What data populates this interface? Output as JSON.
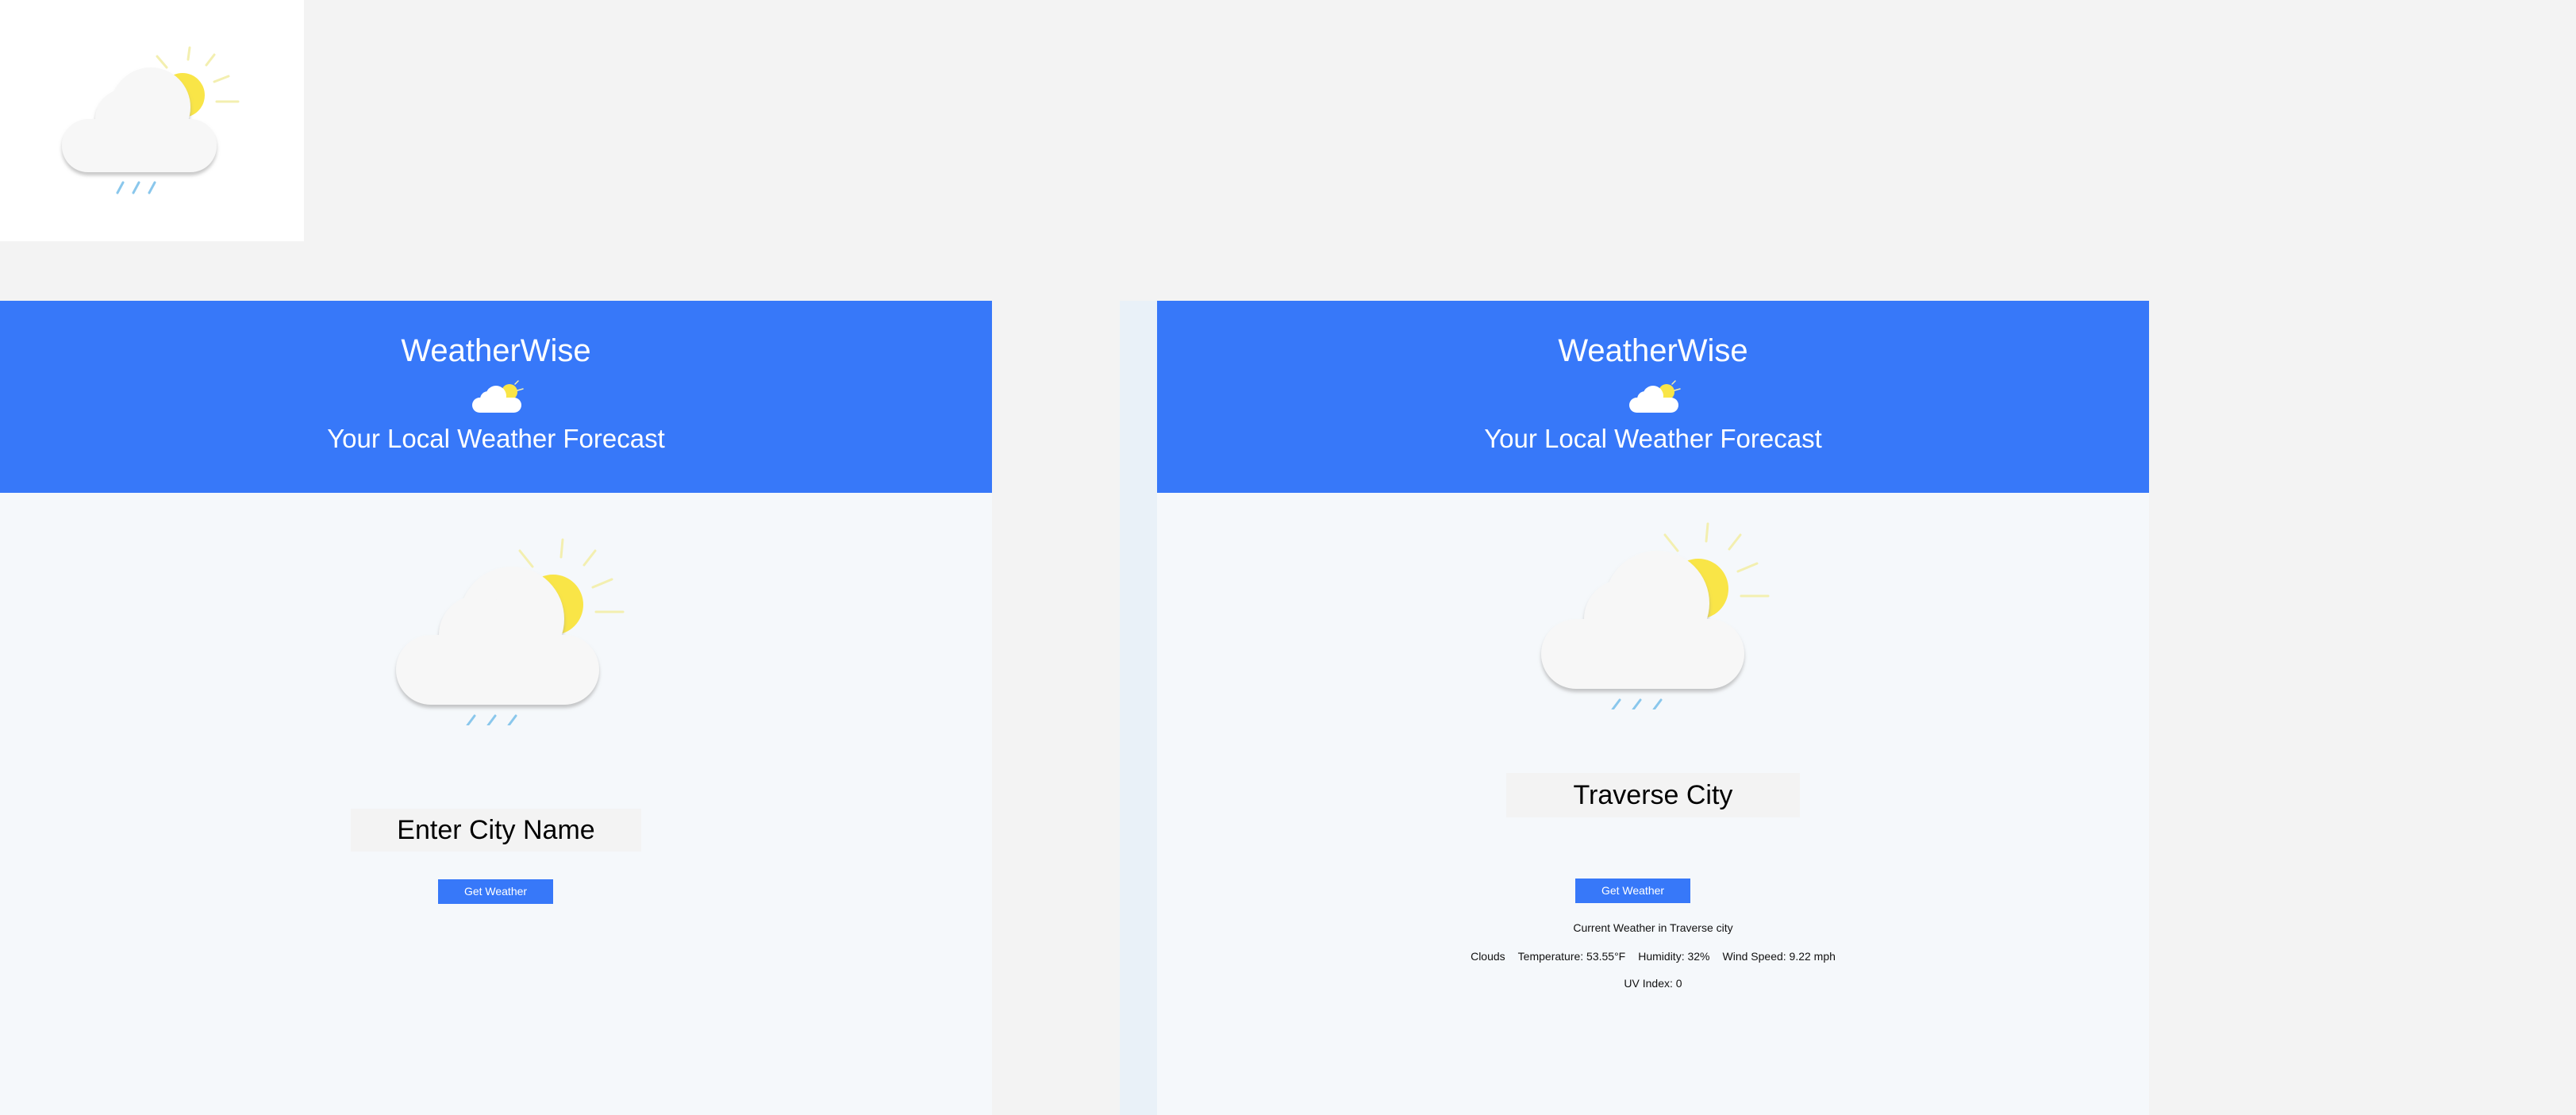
{
  "app": {
    "title": "WeatherWise",
    "subtitle": "Your Local Weather Forecast"
  },
  "icons": {
    "app_logo": "partly-cloudy-rain-icon",
    "header_icon": "partly-cloudy-icon",
    "weather_illustration": "partly-cloudy-rain-icon"
  },
  "colors": {
    "header_background": "#3778f9",
    "button_background": "#3778f9",
    "panel_background": "#f5f8fb",
    "sun": "#f9e547",
    "rain": "#8ac7ec",
    "cloud": "#f7f7f7"
  },
  "left_panel": {
    "city_input": {
      "value": "",
      "placeholder": "Enter City Name"
    },
    "get_weather_label": "Get Weather"
  },
  "right_panel": {
    "city_input": {
      "value": "Traverse City",
      "placeholder": "Enter City Name"
    },
    "get_weather_label": "Get Weather",
    "result": {
      "heading": "Current Weather in Traverse city",
      "condition": "Clouds",
      "temperature": "Temperature: 53.55°F",
      "humidity": "Humidity: 32%",
      "wind_speed": "Wind Speed: 9.22 mph",
      "uv_index": "UV Index: 0"
    }
  }
}
